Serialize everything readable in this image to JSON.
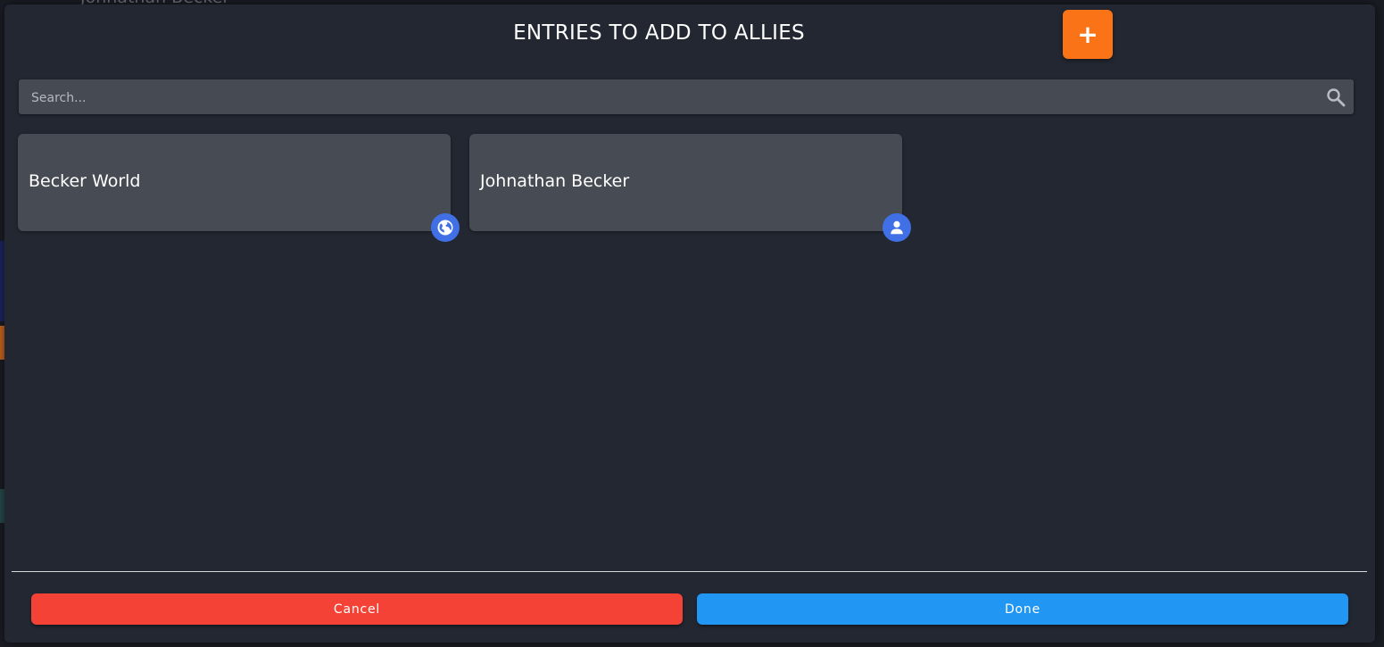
{
  "background": {
    "peek_text": "Johnathan Becker"
  },
  "modal": {
    "title": "ENTRIES TO ADD TO ALLIES",
    "add_button_label": "+",
    "search": {
      "placeholder": "Search...",
      "value": "",
      "icon": "search-icon"
    },
    "entries": [
      {
        "label": "Becker World",
        "badge_icon": "globe-icon"
      },
      {
        "label": "Johnathan Becker",
        "badge_icon": "person-icon"
      }
    ],
    "footer": {
      "cancel_label": "Cancel",
      "done_label": "Done"
    }
  },
  "colors": {
    "modal_bg": "#222731",
    "card_bg": "#474b53",
    "accent_orange": "#fa7317",
    "cancel_red": "#f44236",
    "done_blue": "#2196f3",
    "badge_blue": "#4170e6"
  }
}
